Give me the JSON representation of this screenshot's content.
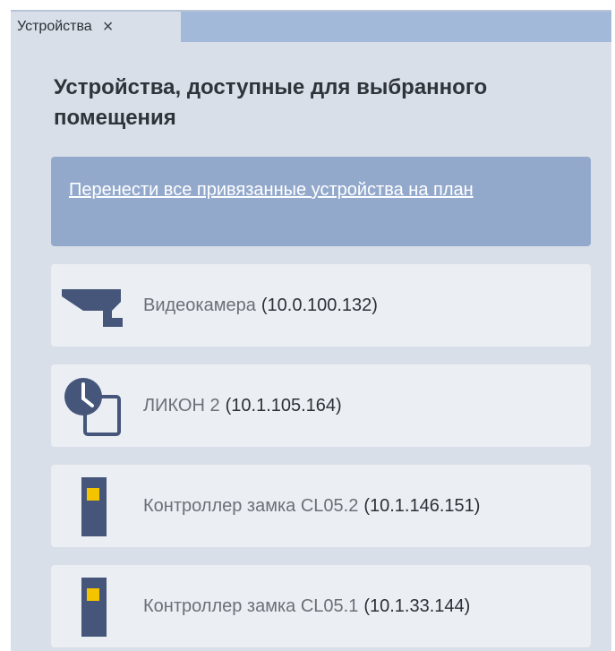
{
  "tab": {
    "label": "Устройства",
    "close_glyph": "×"
  },
  "section": {
    "title": "Устройства, доступные для выбранного помещения",
    "move_all_link": "Перенести все привязанные устройства на план"
  },
  "devices": [
    {
      "name": "Видеокамера",
      "address": "(10.0.100.132)",
      "icon": "camera-icon"
    },
    {
      "name": "ЛИКОН 2",
      "address": "(10.1.105.164)",
      "icon": "clock-reader-icon"
    },
    {
      "name": "Контроллер замка CL05.2",
      "address": "(10.1.146.151)",
      "icon": "lock-controller-icon"
    },
    {
      "name": "Контроллер замка CL05.1",
      "address": "(10.1.33.144)",
      "icon": "lock-controller-icon"
    }
  ],
  "colors": {
    "panel_bg": "#d9dfe8",
    "tabbar_bg": "#a2b9d9",
    "link_button_bg": "#93a9cc",
    "card_bg": "#ebeef3",
    "icon_dark": "#45567a",
    "icon_accent": "#f5c400"
  }
}
